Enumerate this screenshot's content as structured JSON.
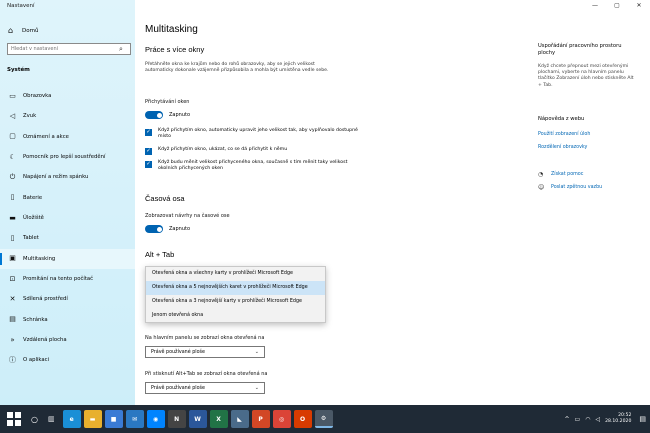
{
  "window": {
    "title": "Nastavení",
    "controls": [
      "—",
      "▢",
      "✕"
    ]
  },
  "sidebar": {
    "home_label": "Domů",
    "search_placeholder": "Hledat v nastavení",
    "section": "Systém",
    "items": [
      {
        "label": "Obrazovka",
        "icon": "monitor-icon"
      },
      {
        "label": "Zvuk",
        "icon": "speaker-icon"
      },
      {
        "label": "Oznámení a akce",
        "icon": "notification-icon"
      },
      {
        "label": "Pomocník pro lepší soustředění",
        "icon": "moon-icon"
      },
      {
        "label": "Napájení a režim spánku",
        "icon": "power-icon"
      },
      {
        "label": "Baterie",
        "icon": "battery-icon"
      },
      {
        "label": "Úložiště",
        "icon": "storage-icon"
      },
      {
        "label": "Tablet",
        "icon": "tablet-icon"
      },
      {
        "label": "Multitasking",
        "icon": "multitasking-icon",
        "active": true
      },
      {
        "label": "Promítání na tento počítač",
        "icon": "projecting-icon"
      },
      {
        "label": "Sdílená prostředí",
        "icon": "shared-experiences-icon"
      },
      {
        "label": "Schránka",
        "icon": "clipboard-icon"
      },
      {
        "label": "Vzdálená plocha",
        "icon": "remote-desktop-icon"
      },
      {
        "label": "O aplikaci",
        "icon": "info-icon"
      }
    ]
  },
  "main": {
    "title": "Multitasking",
    "snap": {
      "heading": "Práce s více okny",
      "description": "Přetáhněte okna ke krajům nebo do rohů obrazovky, aby se jejich velikost automaticky dokonale vzájemně přizpůsobila a mohla být umístěna vedle sebe.",
      "toggle_label": "Přichytávání oken",
      "toggle_state": "Zapnuto",
      "checkboxes": [
        "Když přichytím okno, automaticky upravit jeho velikost tak, aby vyplňovalo dostupné místo",
        "Když přichytím okno, ukázat, co se dá přichytit k němu",
        "Když budu měnit velikost přichyceného okna, současně s tím měnit taky velikost okolních přichycených oken"
      ]
    },
    "timeline": {
      "heading": "Časová osa",
      "toggle_label": "Zobrazovat návrhy na časové ose",
      "toggle_state": "Zapnuto"
    },
    "alttab": {
      "heading": "Alt + Tab",
      "options": [
        "Otevřená okna a všechny karty v prohlížeči Microsoft Edge",
        "Otevřená okna a 5 nejnovějších karet v prohlížeči Microsoft Edge",
        "Otevřená okna a 3 nejnovější karty v prohlížeči Microsoft Edge",
        "Jenom otevřená okna"
      ],
      "selected_index": 1
    },
    "taskbar_label": "Na hlavním panelu se zobrazí okna otevřená na",
    "taskbar_value": "Právě používané ploše",
    "alttab_label": "Při stisknutí Alt+Tab se zobrazí okna otevřená na",
    "alttab_value": "Právě používané ploše"
  },
  "right": {
    "heading": "Uspořádání pracovního prostoru plochy",
    "description": "Když chcete přepnout mezi otevřenými plochami, vyberte na hlavním panelu tlačítko Zobrazení úloh nebo stiskněte Alt + Tab.",
    "help_heading": "Nápověda z webu",
    "links": [
      "Použití zobrazení úloh",
      "Rozdělení obrazovky"
    ],
    "actions": [
      {
        "label": "Získat pomoc",
        "icon": "help-icon"
      },
      {
        "label": "Poslat zpětnou vazbu",
        "icon": "feedback-icon"
      }
    ]
  },
  "taskbar": {
    "time": "20:52",
    "date": "28.10.2020",
    "apps": [
      {
        "name": "edge-icon",
        "glyph": "e",
        "color": "#1a8fd6"
      },
      {
        "name": "file-explorer-icon",
        "glyph": "▬",
        "color": "#e8b02e"
      },
      {
        "name": "store-icon",
        "glyph": "■",
        "color": "#3a7bd5"
      },
      {
        "name": "mail-icon",
        "glyph": "✉",
        "color": "#2a78c2"
      },
      {
        "name": "messenger-icon",
        "glyph": "◉",
        "color": "#0084ff"
      },
      {
        "name": "app-icon",
        "glyph": "N",
        "color": "#444444"
      },
      {
        "name": "word-icon",
        "glyph": "W",
        "color": "#2b579a"
      },
      {
        "name": "excel-icon",
        "glyph": "X",
        "color": "#217346"
      },
      {
        "name": "photos-icon",
        "glyph": "◣",
        "color": "#4a6b8a"
      },
      {
        "name": "powerpoint-icon",
        "glyph": "P",
        "color": "#d24726"
      },
      {
        "name": "chrome-icon",
        "glyph": "◎",
        "color": "#db4437"
      },
      {
        "name": "office-icon",
        "glyph": "O",
        "color": "#d83b01"
      },
      {
        "name": "settings-icon",
        "glyph": "⚙",
        "color": "#4a5866"
      }
    ]
  }
}
